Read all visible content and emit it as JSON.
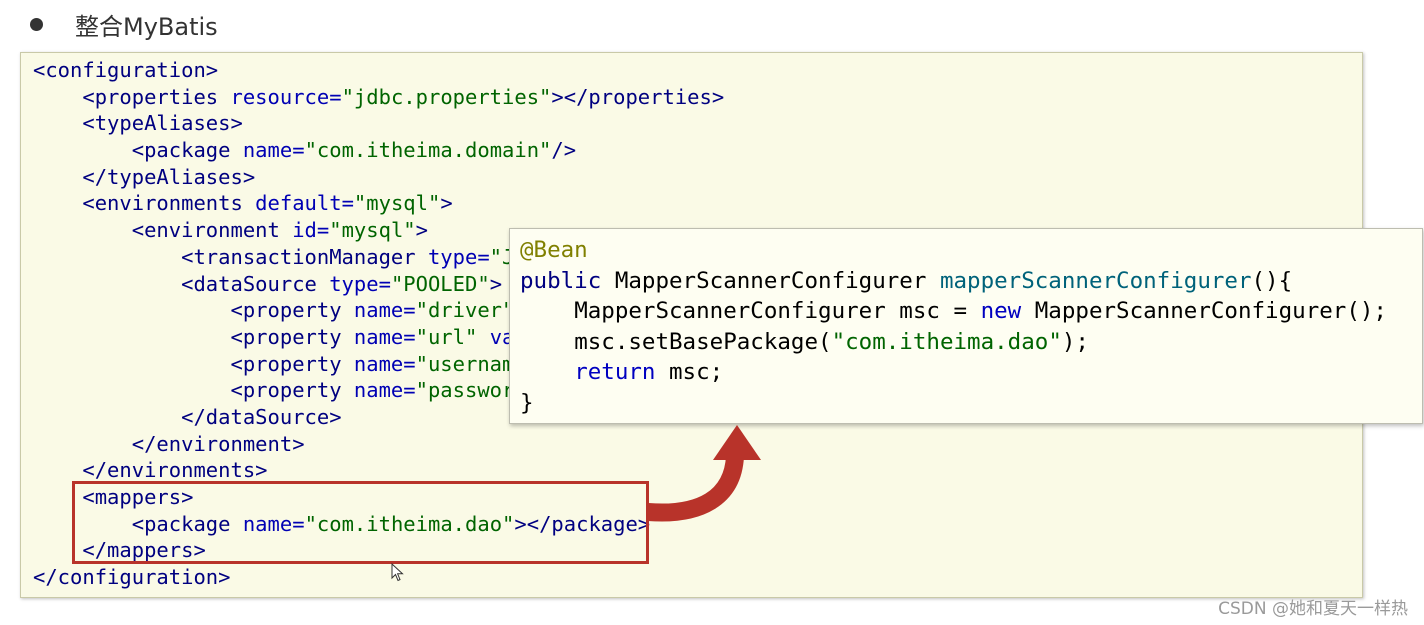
{
  "heading": {
    "bullet_icon": "bullet-dot-icon",
    "title": "整合MyBatis"
  },
  "xml_lines": [
    {
      "indent": 0,
      "tokens": [
        {
          "t": "tag",
          "v": "<configuration>"
        }
      ]
    },
    {
      "indent": 1,
      "tokens": [
        {
          "t": "tag",
          "v": "<properties "
        },
        {
          "t": "attr",
          "v": "resource="
        },
        {
          "t": "val",
          "v": "\"jdbc.properties\""
        },
        {
          "t": "tag",
          "v": "></properties>"
        }
      ]
    },
    {
      "indent": 1,
      "tokens": [
        {
          "t": "tag",
          "v": "<typeAliases>"
        }
      ]
    },
    {
      "indent": 2,
      "tokens": [
        {
          "t": "tag",
          "v": "<package "
        },
        {
          "t": "attr",
          "v": "name="
        },
        {
          "t": "val",
          "v": "\"com.itheima.domain\""
        },
        {
          "t": "tag",
          "v": "/>"
        }
      ]
    },
    {
      "indent": 1,
      "tokens": [
        {
          "t": "tag",
          "v": "</typeAliases>"
        }
      ]
    },
    {
      "indent": 1,
      "tokens": [
        {
          "t": "tag",
          "v": "<environments "
        },
        {
          "t": "attr",
          "v": "default="
        },
        {
          "t": "val",
          "v": "\"mysql\""
        },
        {
          "t": "tag",
          "v": ">"
        }
      ]
    },
    {
      "indent": 2,
      "tokens": [
        {
          "t": "tag",
          "v": "<environment "
        },
        {
          "t": "attr",
          "v": "id="
        },
        {
          "t": "val",
          "v": "\"mysql\""
        },
        {
          "t": "tag",
          "v": ">"
        }
      ]
    },
    {
      "indent": 3,
      "tokens": [
        {
          "t": "tag",
          "v": "<transactionManager "
        },
        {
          "t": "attr",
          "v": "type="
        },
        {
          "t": "val",
          "v": "\"J"
        }
      ]
    },
    {
      "indent": 3,
      "tokens": [
        {
          "t": "tag",
          "v": "<dataSource "
        },
        {
          "t": "attr",
          "v": "type="
        },
        {
          "t": "val",
          "v": "\"POOLED\""
        },
        {
          "t": "tag",
          "v": ">"
        }
      ]
    },
    {
      "indent": 4,
      "tokens": [
        {
          "t": "tag",
          "v": "<property "
        },
        {
          "t": "attr",
          "v": "name="
        },
        {
          "t": "val",
          "v": "\"driver\""
        }
      ]
    },
    {
      "indent": 4,
      "tokens": [
        {
          "t": "tag",
          "v": "<property "
        },
        {
          "t": "attr",
          "v": "name="
        },
        {
          "t": "val",
          "v": "\"url\" "
        },
        {
          "t": "attr",
          "v": "va"
        }
      ]
    },
    {
      "indent": 4,
      "tokens": [
        {
          "t": "tag",
          "v": "<property "
        },
        {
          "t": "attr",
          "v": "name="
        },
        {
          "t": "val",
          "v": "\"usernam"
        }
      ]
    },
    {
      "indent": 4,
      "tokens": [
        {
          "t": "tag",
          "v": "<property "
        },
        {
          "t": "attr",
          "v": "name="
        },
        {
          "t": "val",
          "v": "\"passwor"
        }
      ]
    },
    {
      "indent": 3,
      "tokens": [
        {
          "t": "tag",
          "v": "</dataSource>"
        }
      ]
    },
    {
      "indent": 2,
      "tokens": [
        {
          "t": "tag",
          "v": "</environment>"
        }
      ]
    },
    {
      "indent": 1,
      "tokens": [
        {
          "t": "tag",
          "v": "</environments>"
        }
      ]
    },
    {
      "indent": 1,
      "tokens": [
        {
          "t": "tag",
          "v": "<mappers>"
        }
      ]
    },
    {
      "indent": 2,
      "tokens": [
        {
          "t": "tag",
          "v": "<package "
        },
        {
          "t": "attr",
          "v": "name="
        },
        {
          "t": "val",
          "v": "\"com.itheima.dao\""
        },
        {
          "t": "tag",
          "v": "></package>"
        }
      ]
    },
    {
      "indent": 1,
      "tokens": [
        {
          "t": "tag",
          "v": "</mappers>"
        }
      ]
    },
    {
      "indent": 0,
      "tokens": [
        {
          "t": "tag",
          "v": "</configuration>"
        }
      ]
    }
  ],
  "java_lines": [
    {
      "indent": 0,
      "tokens": [
        {
          "t": "ann",
          "v": "@Bean"
        }
      ]
    },
    {
      "indent": 0,
      "tokens": [
        {
          "t": "kw",
          "v": "public "
        },
        {
          "t": "plain",
          "v": "MapperScannerConfigurer "
        },
        {
          "t": "method",
          "v": "mapperScannerConfigurer"
        },
        {
          "t": "plain",
          "v": "(){"
        }
      ]
    },
    {
      "indent": 1,
      "tokens": [
        {
          "t": "plain",
          "v": "MapperScannerConfigurer msc = "
        },
        {
          "t": "kwb",
          "v": "new "
        },
        {
          "t": "plain",
          "v": "MapperScannerConfigurer();"
        }
      ]
    },
    {
      "indent": 1,
      "tokens": [
        {
          "t": "plain",
          "v": "msc.setBasePackage("
        },
        {
          "t": "str",
          "v": "\"com.itheima.dao\""
        },
        {
          "t": "plain",
          "v": ");"
        }
      ]
    },
    {
      "indent": 1,
      "tokens": [
        {
          "t": "kwb",
          "v": "return "
        },
        {
          "t": "plain",
          "v": "msc;"
        }
      ]
    },
    {
      "indent": 0,
      "tokens": [
        {
          "t": "plain",
          "v": "}"
        }
      ]
    }
  ],
  "highlight": {
    "label": "mappers-block",
    "color": "#b8332a"
  },
  "arrow": {
    "icon": "curved-arrow-icon",
    "color": "#b8332a"
  },
  "cursor": {
    "icon": "mouse-pointer-icon"
  },
  "watermark": "CSDN @她和夏天一样热"
}
